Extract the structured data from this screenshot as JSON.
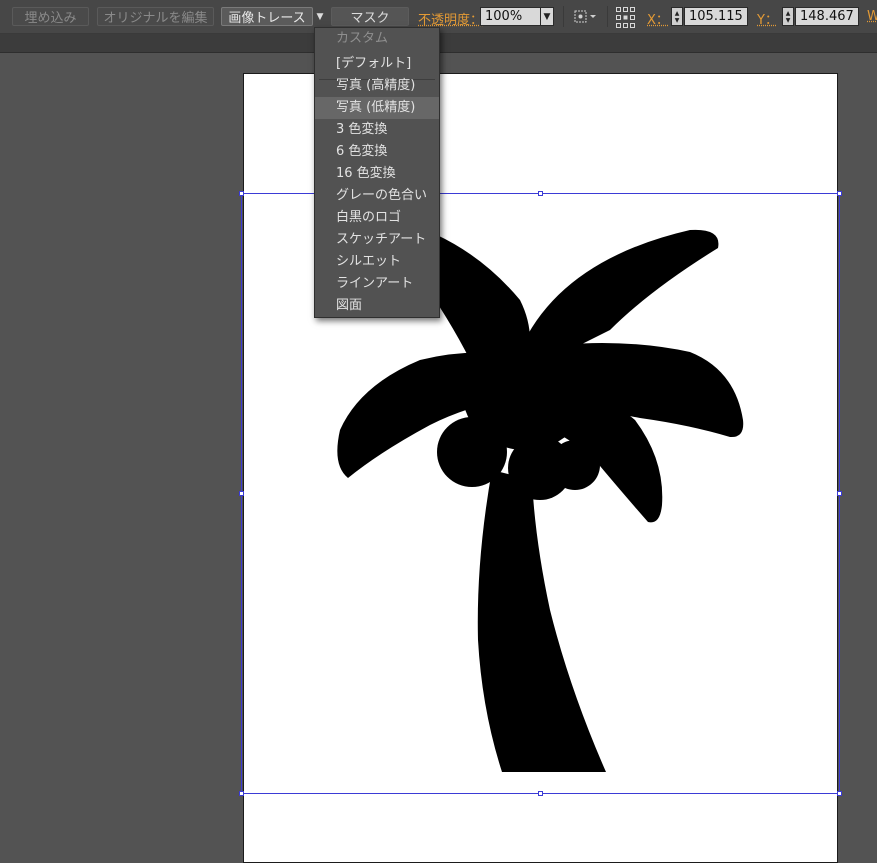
{
  "toolbar": {
    "embed_label": "埋め込み",
    "edit_original_label": "オリジナルを編集",
    "image_trace_label": "画像トレース",
    "mask_label": "マスク",
    "opacity_label": "不透明度：",
    "opacity_value": "100%",
    "x_label": "X：",
    "x_value": "105.115 n",
    "y_label": "Y：",
    "y_value": "148.467 n",
    "w_label": "W"
  },
  "trace_menu": {
    "header": "カスタム",
    "items": [
      "[デフォルト]",
      "写真 (高精度)",
      "写真 (低精度)",
      "3 色変換",
      "6 色変換",
      "16 色変換",
      "グレーの色合い",
      "白黒のロゴ",
      "スケッチアート",
      "シルエット",
      "ラインアート",
      "図面"
    ],
    "hovered_item": "写真 (低精度)"
  },
  "colors": {
    "workspace": "#535353",
    "selection": "#3b3bd6",
    "accent_label": "#e39a35",
    "artwork": "#000000"
  },
  "artwork": {
    "subject": "palm-tree-silhouette"
  }
}
